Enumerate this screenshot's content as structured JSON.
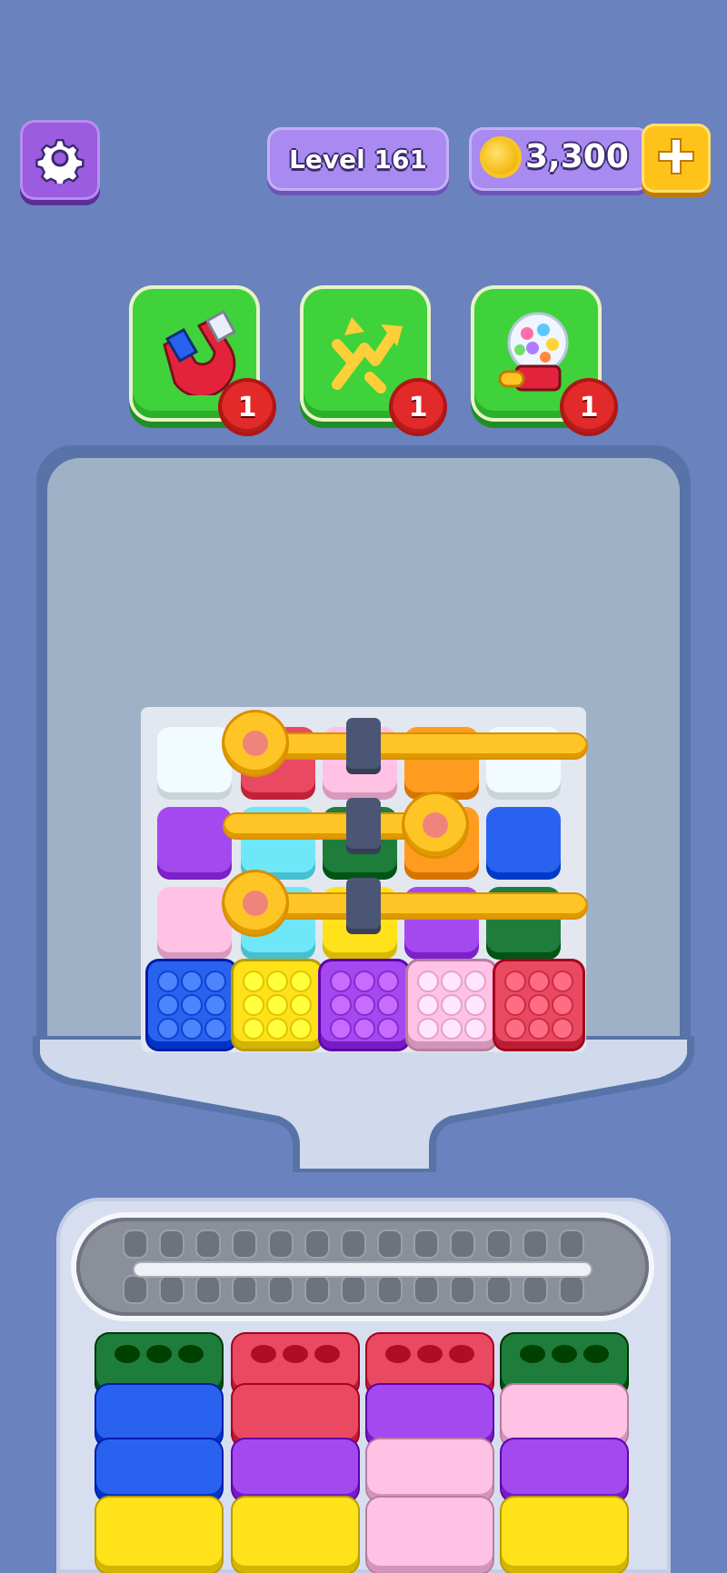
{
  "header": {
    "level_label": "Level 161",
    "coins": "3,300"
  },
  "boosters": [
    {
      "icon": "magnet-icon",
      "count": "1"
    },
    {
      "icon": "shuffle-icon",
      "count": "1"
    },
    {
      "icon": "gumball-machine-icon",
      "count": "1"
    }
  ],
  "colors": {
    "white": "#f2fbff",
    "red": "#e94a62",
    "pink": "#ffc2e4",
    "orange": "#ff9c1f",
    "purple": "#a449f0",
    "cyan": "#6ee8f8",
    "green": "#1f7d3c",
    "blue": "#2a62f0",
    "yellow": "#ffe21a"
  },
  "board": {
    "rows": [
      [
        "white",
        "red",
        "pink",
        "orange",
        "white"
      ],
      [
        "purple",
        "cyan",
        "green",
        "orange",
        "blue"
      ],
      [
        "pink",
        "cyan",
        "yellow",
        "purple",
        "green"
      ]
    ],
    "bubble_row": [
      "blue",
      "yellow",
      "purple",
      "pink",
      "red"
    ]
  },
  "conveyor": {
    "columns": [
      [
        "green",
        "blue",
        "blue",
        "yellow"
      ],
      [
        "red",
        "red",
        "purple",
        "yellow"
      ],
      [
        "red",
        "purple",
        "pink",
        "pink"
      ],
      [
        "green",
        "pink",
        "purple",
        "yellow"
      ]
    ]
  }
}
